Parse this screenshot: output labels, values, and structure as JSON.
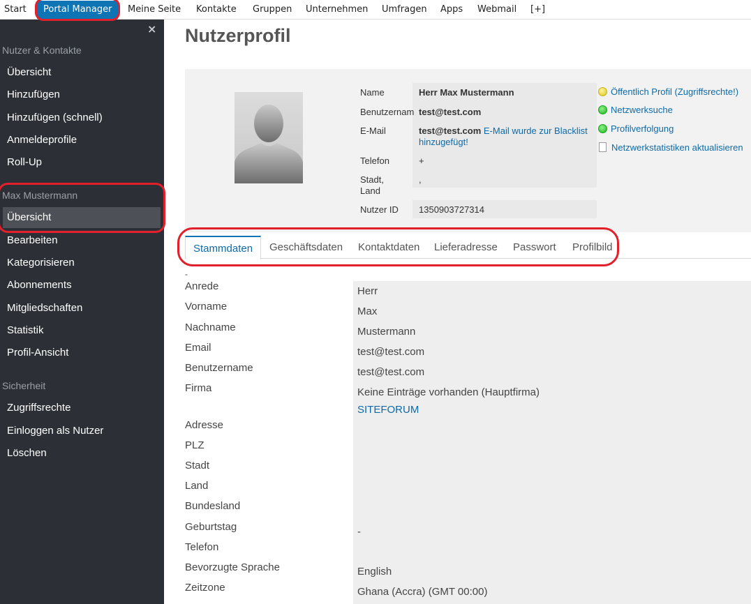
{
  "topnav": {
    "items": [
      "Start",
      "Portal Manager",
      "Meine Seite",
      "Kontakte",
      "Gruppen",
      "Unternehmen",
      "Umfragen",
      "Apps",
      "Webmail",
      "[+]"
    ]
  },
  "sidebar": {
    "close": "×",
    "section1": {
      "title": "Nutzer & Kontakte",
      "items": [
        "Übersicht",
        "Hinzufügen",
        "Hinzufügen (schnell)",
        "Anmeldeprofile",
        "Roll-Up"
      ]
    },
    "section2": {
      "title": "Max Mustermann",
      "items": [
        "Übersicht",
        "Bearbeiten",
        "Kategorisieren",
        "Abonnements",
        "Mitgliedschaften",
        "Statistik",
        "Profil-Ansicht"
      ]
    },
    "section3": {
      "title": "Sicherheit",
      "items": [
        "Zugriffsrechte",
        "Einloggen als Nutzer",
        "Löschen"
      ]
    }
  },
  "main": {
    "title": "Nutzerprofil",
    "profile": {
      "labels": {
        "name": "Name",
        "username": "Benutzernam",
        "email": "E-Mail",
        "phone": "Telefon",
        "city_line1": "Stadt,",
        "city_line2": "Land",
        "user_id": "Nutzer ID"
      },
      "values": {
        "name": "Herr Max Mustermann",
        "username": "test@test.com",
        "email": "test@test.com",
        "email_note_line1": "E-Mail wurde zur Blacklist",
        "email_note_line2": "hinzugefügt!",
        "phone": "+",
        "city": ",",
        "user_id": "1350903727314"
      },
      "actions": [
        {
          "label": "Öffentlich Profil (Zugriffsrechte!)",
          "icon": "yellow-status-dot",
          "color": "#d8c41e"
        },
        {
          "label": "Netzwerksuche",
          "icon": "green-status-dot",
          "color": "#1fb61f"
        },
        {
          "label": "Profilverfolgung",
          "icon": "green-status-dot",
          "color": "#1fb61f"
        },
        {
          "label": "Netzwerkstatistiken aktualisieren",
          "icon": "document-icon"
        }
      ]
    },
    "tabs": [
      "Stammdaten",
      "Geschäftsdaten",
      "Kontaktdaten",
      "Lieferadresse",
      "Passwort",
      "Profilbild"
    ],
    "stammdaten": {
      "dash": "-",
      "labels": [
        "Anrede",
        "Vorname",
        "Nachname",
        "Email",
        "Benutzername",
        "Firma",
        "Adresse",
        "PLZ",
        "Stadt",
        "Land",
        "Bundesland",
        "Geburtstag",
        "Telefon",
        "Bevorzugte Sprache",
        "Zeitzone"
      ],
      "values": {
        "anrede": "Herr",
        "vorname": "Max",
        "nachname": "Mustermann",
        "email": "test@test.com",
        "benutzername": "test@test.com",
        "firma": "Keine Einträge vorhanden (Hauptfirma)",
        "firma_link": "SITEFORUM",
        "geburtstag": "-",
        "sprache": "English",
        "zeitzone": "Ghana (Accra) (GMT 00:00)"
      }
    }
  },
  "colors": {
    "accent": "#0e74b3",
    "sidebar_bg": "#2c3036",
    "highlight": "#e2202b"
  }
}
